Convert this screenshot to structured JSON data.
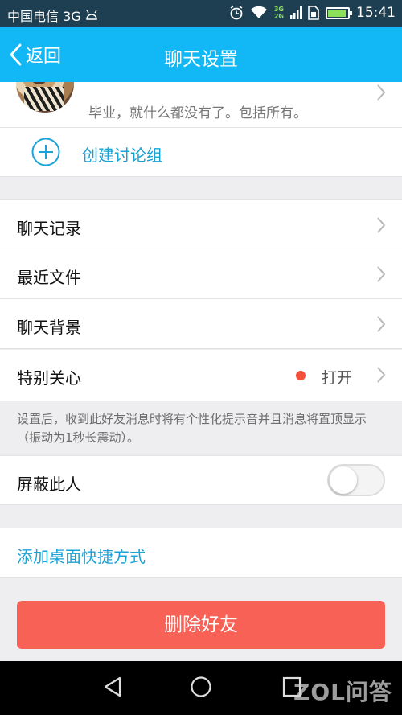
{
  "status_bar": {
    "carrier": "中国电信 3G",
    "net_top": "3G",
    "net_bottom": "2G",
    "time": "15:41",
    "battery_level": 0.85
  },
  "header": {
    "back_label": "返回",
    "title": "聊天设置"
  },
  "profile": {
    "signature": "毕业，就什么都没有了。包括所有。"
  },
  "create_group": {
    "label": "创建讨论组"
  },
  "menu": {
    "chat_history": "聊天记录",
    "recent_files": "最近文件",
    "chat_background": "聊天背景",
    "special_care": {
      "label": "特别关心",
      "value": "打开"
    }
  },
  "hint": "设置后，收到此好友消息时将有个性化提示音并且消息将置顶显示（振动为1秒长震动）。",
  "block": {
    "label": "屏蔽此人",
    "enabled": false
  },
  "shortcut": {
    "label": "添加桌面快捷方式"
  },
  "delete_button": {
    "label": "删除好友"
  },
  "watermark": "ZOL问答",
  "colors": {
    "accent": "#12b7f5",
    "link": "#1aa3d6",
    "danger": "#f86155",
    "dot": "#f4513c"
  }
}
